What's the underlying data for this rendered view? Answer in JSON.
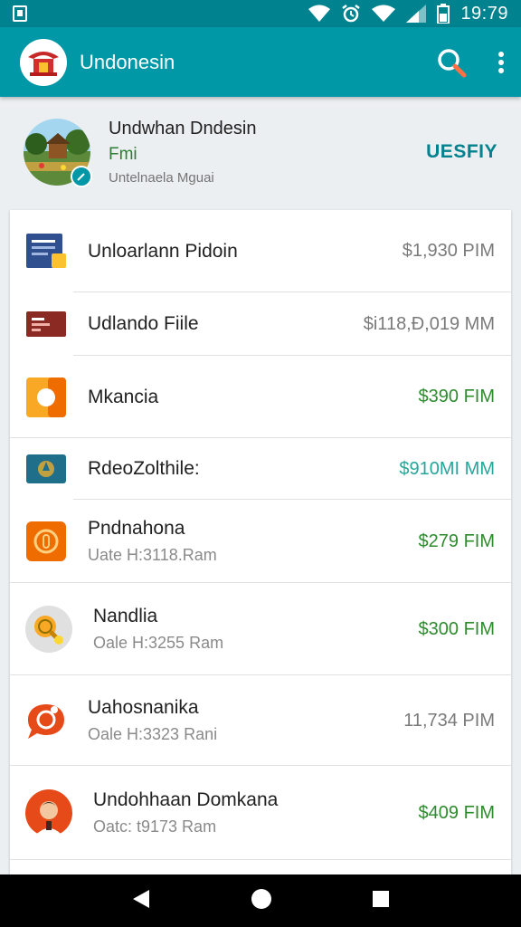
{
  "status_bar": {
    "time": "19:79"
  },
  "app_bar": {
    "title": "Undonesin"
  },
  "profile": {
    "name": "Undwhan Dndesin",
    "subtitle": "Fmi",
    "meta": "Untelnaela Mguai",
    "action_label": "UESFIY"
  },
  "transactions": [
    {
      "title": "Unloarlann Pidoin",
      "subtitle": "",
      "amount": "$1,930 PIM",
      "amount_color": "#7a7a7a",
      "icon": "document-icon"
    },
    {
      "title": "Udlando Fiile",
      "subtitle": "",
      "amount": "$i118,Đ,019 MM",
      "amount_color": "#7a7a7a",
      "icon": "file-icon"
    },
    {
      "title": "Mkancia",
      "subtitle": "",
      "amount": "$390 FIM",
      "amount_color": "#2e8b2e",
      "icon": "media-icon"
    },
    {
      "title": "RdeoZolthile:",
      "subtitle": "",
      "amount": "$910MI MM",
      "amount_color": "#26a69a",
      "icon": "map-pin-icon"
    },
    {
      "title": "Pndnahona",
      "subtitle": "Uate H:3118.Ram",
      "amount": "$279 FIM",
      "amount_color": "#2e8b2e",
      "icon": "coin-icon"
    },
    {
      "title": "Nandlia",
      "subtitle": "Oale H:3255 Ram",
      "amount": "$300 FIM",
      "amount_color": "#2e8b2e",
      "icon": "search-coin-icon"
    },
    {
      "title": "Uahosnanika",
      "subtitle": "Oale H:3323 Rani",
      "amount": "11,734 PIM",
      "amount_color": "#7a7a7a",
      "icon": "chat-bubble-icon"
    },
    {
      "title": "Undohhaan Domkana",
      "subtitle": "Oatc: t9173 Ram",
      "amount": "$409 FIM",
      "amount_color": "#2e8b2e",
      "icon": "person-avatar-icon"
    }
  ]
}
